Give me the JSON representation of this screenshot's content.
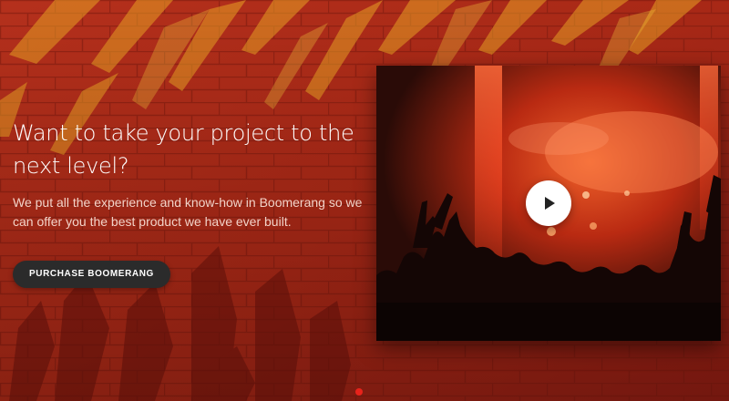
{
  "hero": {
    "title": "Want to take your project to the next level?",
    "text": "We put all the experience and know-how in Boomerang so we can offer you the best product we have ever built.",
    "cta_label": "PURCHASE BOOMERANG"
  },
  "video": {
    "play_icon": "play-icon"
  },
  "colors": {
    "background": "#a52a18",
    "accent": "#e8231b",
    "button": "#2b2b2b",
    "text": "#ffffff"
  }
}
